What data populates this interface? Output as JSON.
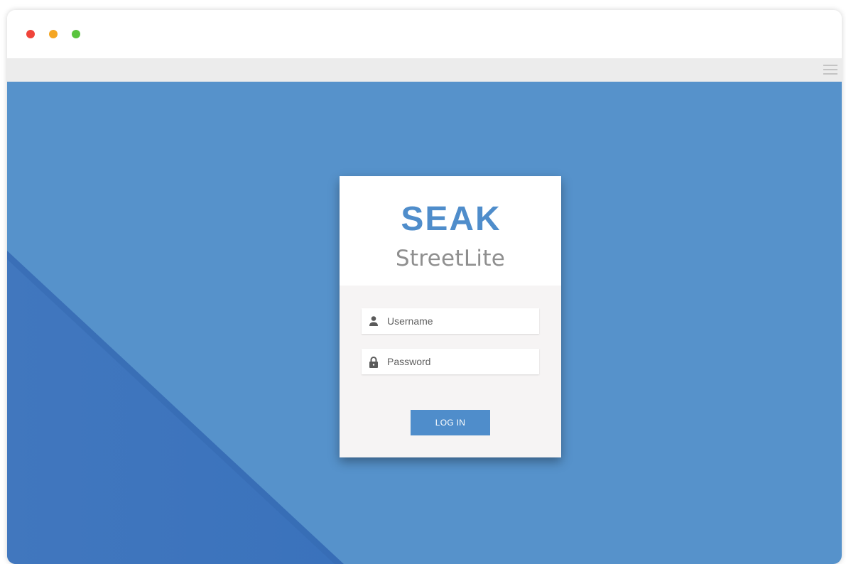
{
  "window": {
    "traffic_lights": {
      "close_color": "#f0443a",
      "minimize_color": "#f5a623",
      "maximize_color": "#5ac43e"
    },
    "menu_icon": "hamburger-menu-icon"
  },
  "page": {
    "background_color": "#5692cb",
    "accent_dark": "#3a74bd"
  },
  "login": {
    "logo_brand": "SEAK",
    "logo_product": "StreetLite",
    "username": {
      "placeholder": "Username",
      "value": "",
      "icon": "user-icon"
    },
    "password": {
      "placeholder": "Password",
      "value": "",
      "icon": "lock-icon"
    },
    "submit_label": "LOG IN",
    "brand_color": "#4f8dcb"
  }
}
